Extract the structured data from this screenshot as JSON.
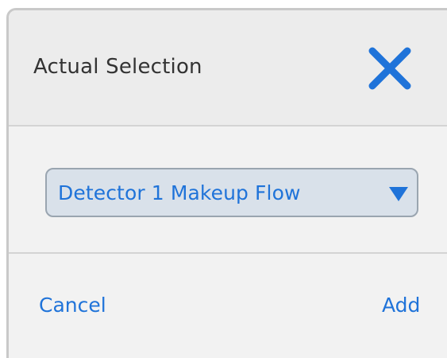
{
  "dialog": {
    "title": "Actual Selection",
    "close_icon": "close-icon",
    "accent_color": "#1f73d9"
  },
  "selector": {
    "selected_value": "Detector 1 Makeup Flow",
    "chevron_icon": "chevron-down-icon"
  },
  "footer": {
    "cancel_label": "Cancel",
    "add_label": "Add"
  }
}
